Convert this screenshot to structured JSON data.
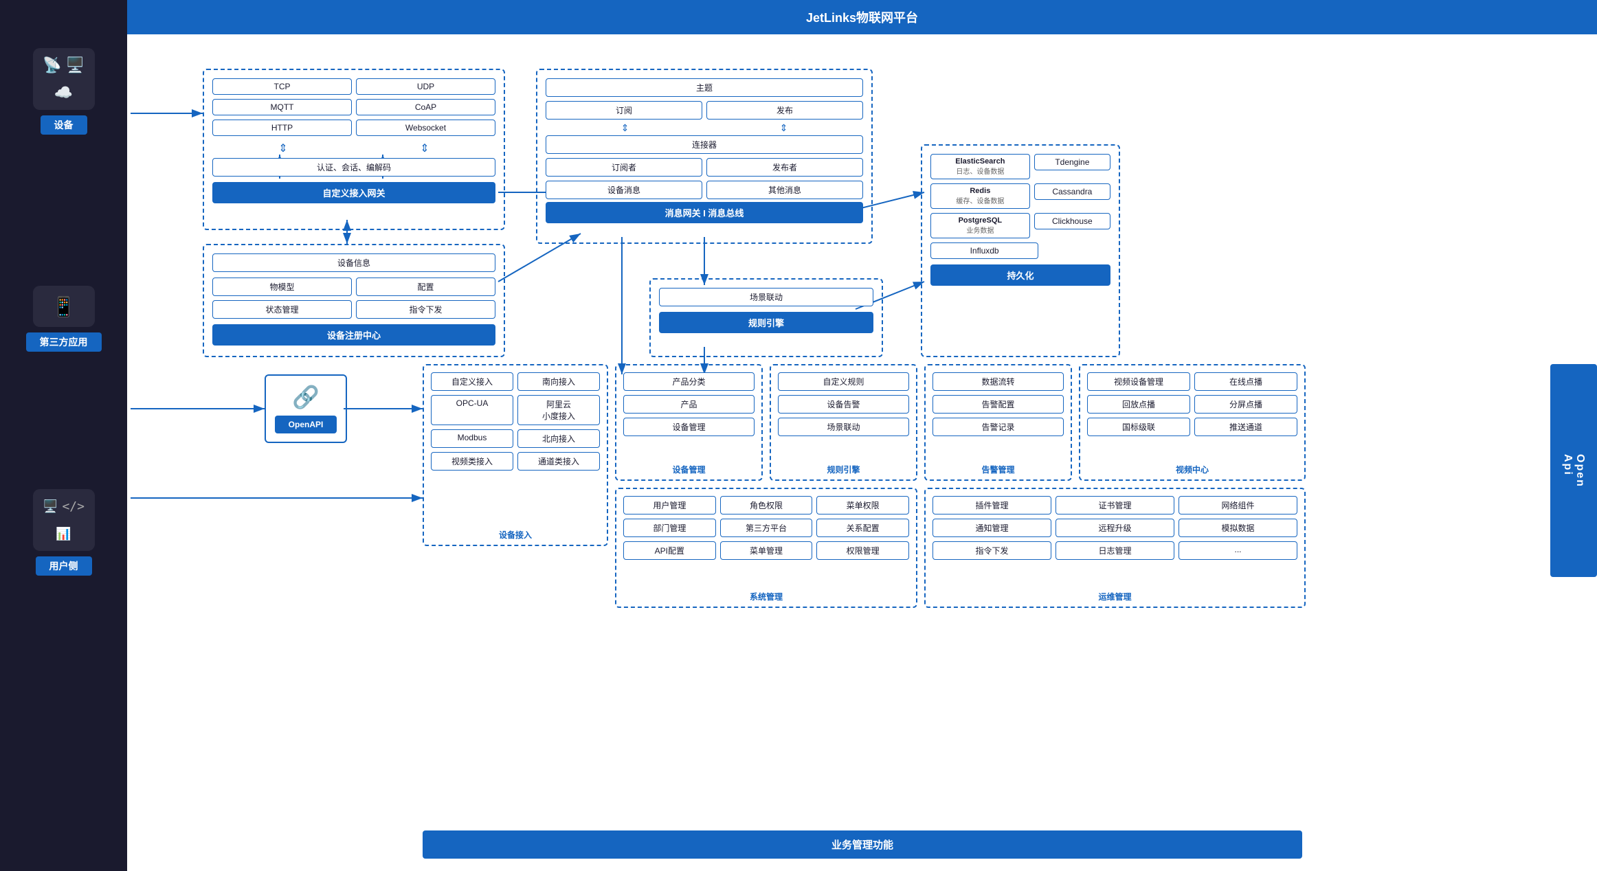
{
  "platform": {
    "title": "JetLinks物联网平台"
  },
  "sidebar": {
    "groups": [
      {
        "id": "device",
        "label": "设备",
        "icons": [
          "📡",
          "🖥️",
          "☁️"
        ]
      },
      {
        "id": "third-party",
        "label": "第三方应用",
        "icons": [
          "📱"
        ]
      },
      {
        "id": "user-side",
        "label": "用户侧",
        "icons": [
          "🖥️",
          "</>",
          "📊"
        ]
      }
    ]
  },
  "gateway": {
    "title": "自定义接入网关",
    "protocols": [
      "TCP",
      "UDP",
      "MQTT",
      "CoAP",
      "HTTP",
      "Websocket"
    ],
    "auth_label": "认证、会话、编解码"
  },
  "device_info": {
    "title": "设备信息",
    "items": [
      "物模型",
      "配置",
      "状态管理",
      "指令下发"
    ],
    "register_label": "设备注册中心"
  },
  "message_bus": {
    "connector_label": "连接器",
    "topic_label": "主题",
    "subscribe_label": "订阅",
    "publish_label": "发布",
    "subscriber_label": "订阅者",
    "publisher_label": "发布者",
    "device_msg_label": "设备消息",
    "other_msg_label": "其他消息",
    "gateway_label": "消息网关 I 消息总线"
  },
  "rule_engine": {
    "scene_label": "场景联动",
    "rule_label": "规则引擎"
  },
  "persistence": {
    "title": "持久化",
    "items": [
      {
        "name": "ElasticSearch",
        "desc": "日志、设备数据"
      },
      {
        "name": "Tdengine",
        "desc": ""
      },
      {
        "name": "Redis",
        "desc": "缓存、设备数据"
      },
      {
        "name": "Cassandra",
        "desc": ""
      },
      {
        "name": "PostgreSQL",
        "desc": "业务数据"
      },
      {
        "name": "Clickhouse",
        "desc": ""
      },
      {
        "name": "Influxdb",
        "desc": ""
      }
    ]
  },
  "openapi": {
    "label": "OpenAPI",
    "icon": "🔗"
  },
  "device_access": {
    "section_label": "设备接入",
    "items": [
      [
        "自定义接入",
        "南向接入"
      ],
      [
        "OPC-UA",
        "阿里云\n小度接入"
      ],
      [
        "Modbus",
        "北向接入"
      ],
      [
        "视频类接入",
        "通道类接入"
      ]
    ]
  },
  "device_management": {
    "section_label": "设备管理",
    "items": [
      "产品分类",
      "产品",
      "设备管理"
    ]
  },
  "rule_management": {
    "section_label": "规则引擎",
    "items": [
      "自定义规则",
      "设备告警",
      "场景联动"
    ]
  },
  "alarm_management": {
    "section_label": "告警管理",
    "items": [
      "数据流转",
      "告警配置",
      "告警记录"
    ]
  },
  "video_center": {
    "section_label": "视频中心",
    "items": [
      "视频设备管理",
      "在线点播",
      "回放点播",
      "分屏点播",
      "国标级联",
      "推送通道"
    ]
  },
  "system_management": {
    "section_label": "系统管理",
    "items": [
      [
        "用户管理",
        "角色权限",
        "菜单权限"
      ],
      [
        "部门管理",
        "第三方平台",
        "关系配置"
      ],
      [
        "API配置",
        "菜单管理",
        "权限管理"
      ]
    ]
  },
  "ops_management": {
    "section_label": "运维管理",
    "items": [
      [
        "插件管理",
        "证书管理",
        "网络组件"
      ],
      [
        "通知管理",
        "远程升级",
        "模拟数据"
      ],
      [
        "指令下发",
        "日志管理",
        "..."
      ]
    ]
  },
  "business_label": "业务管理功能",
  "open_api_right": "Open\nApi"
}
